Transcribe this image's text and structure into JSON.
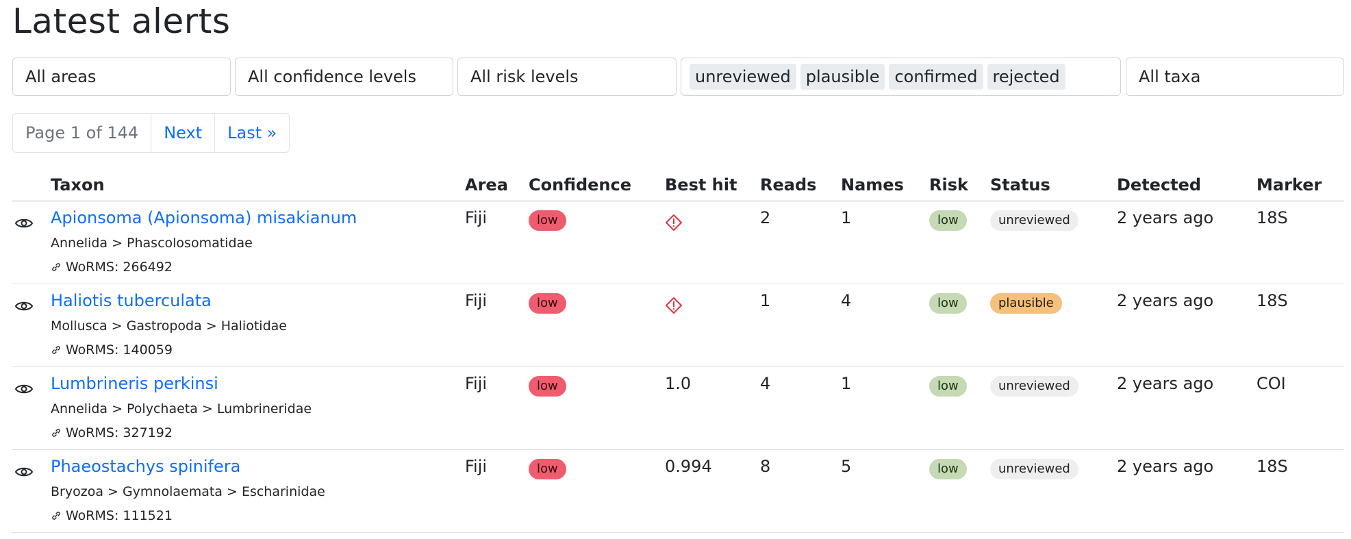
{
  "page": {
    "title": "Latest alerts"
  },
  "filters": {
    "area": "All areas",
    "confidence": "All confidence levels",
    "risk": "All risk levels",
    "status_tags": [
      "unreviewed",
      "plausible",
      "confirmed",
      "rejected"
    ],
    "taxa": "All taxa"
  },
  "pagination": {
    "info": "Page 1 of 144",
    "next": "Next",
    "last": "Last »"
  },
  "table": {
    "headers": [
      "Taxon",
      "Area",
      "Confidence",
      "Best hit",
      "Reads",
      "Names",
      "Risk",
      "Status",
      "Detected",
      "Marker"
    ],
    "rows": [
      {
        "taxon": "Apionsoma (Apionsoma) misakianum",
        "lineage": "Annelida > Phascolosomatidae",
        "worms": "WoRMS: 266492",
        "area": "Fiji",
        "confidence": "low",
        "best_hit": "",
        "best_hit_icon": "warning-diamond-icon",
        "reads": "2",
        "names": "1",
        "risk": "low",
        "status": "unreviewed",
        "detected": "2 years ago",
        "marker": "18S"
      },
      {
        "taxon": "Haliotis tuberculata",
        "lineage": "Mollusca > Gastropoda > Haliotidae",
        "worms": "WoRMS: 140059",
        "area": "Fiji",
        "confidence": "low",
        "best_hit": "",
        "best_hit_icon": "warning-diamond-icon",
        "reads": "1",
        "names": "4",
        "risk": "low",
        "status": "plausible",
        "detected": "2 years ago",
        "marker": "18S"
      },
      {
        "taxon": "Lumbrineris perkinsi",
        "lineage": "Annelida > Polychaeta > Lumbrineridae",
        "worms": "WoRMS: 327192",
        "area": "Fiji",
        "confidence": "low",
        "best_hit": "1.0",
        "best_hit_icon": "",
        "reads": "4",
        "names": "1",
        "risk": "low",
        "status": "unreviewed",
        "detected": "2 years ago",
        "marker": "COI"
      },
      {
        "taxon": "Phaeostachys spinifera",
        "lineage": "Bryozoa > Gymnolaemata > Escharinidae",
        "worms": "WoRMS: 111521",
        "area": "Fiji",
        "confidence": "low",
        "best_hit": "0.994",
        "best_hit_icon": "",
        "reads": "8",
        "names": "5",
        "risk": "low",
        "status": "unreviewed",
        "detected": "2 years ago",
        "marker": "18S"
      }
    ]
  },
  "colors": {
    "link": "#0d6efd",
    "confidence_low": "#f05c6f",
    "risk_low": "#c5d9b4",
    "status_plausible": "#f3c07d",
    "status_unreviewed": "#eeeeee",
    "warning": "#dc3545"
  }
}
